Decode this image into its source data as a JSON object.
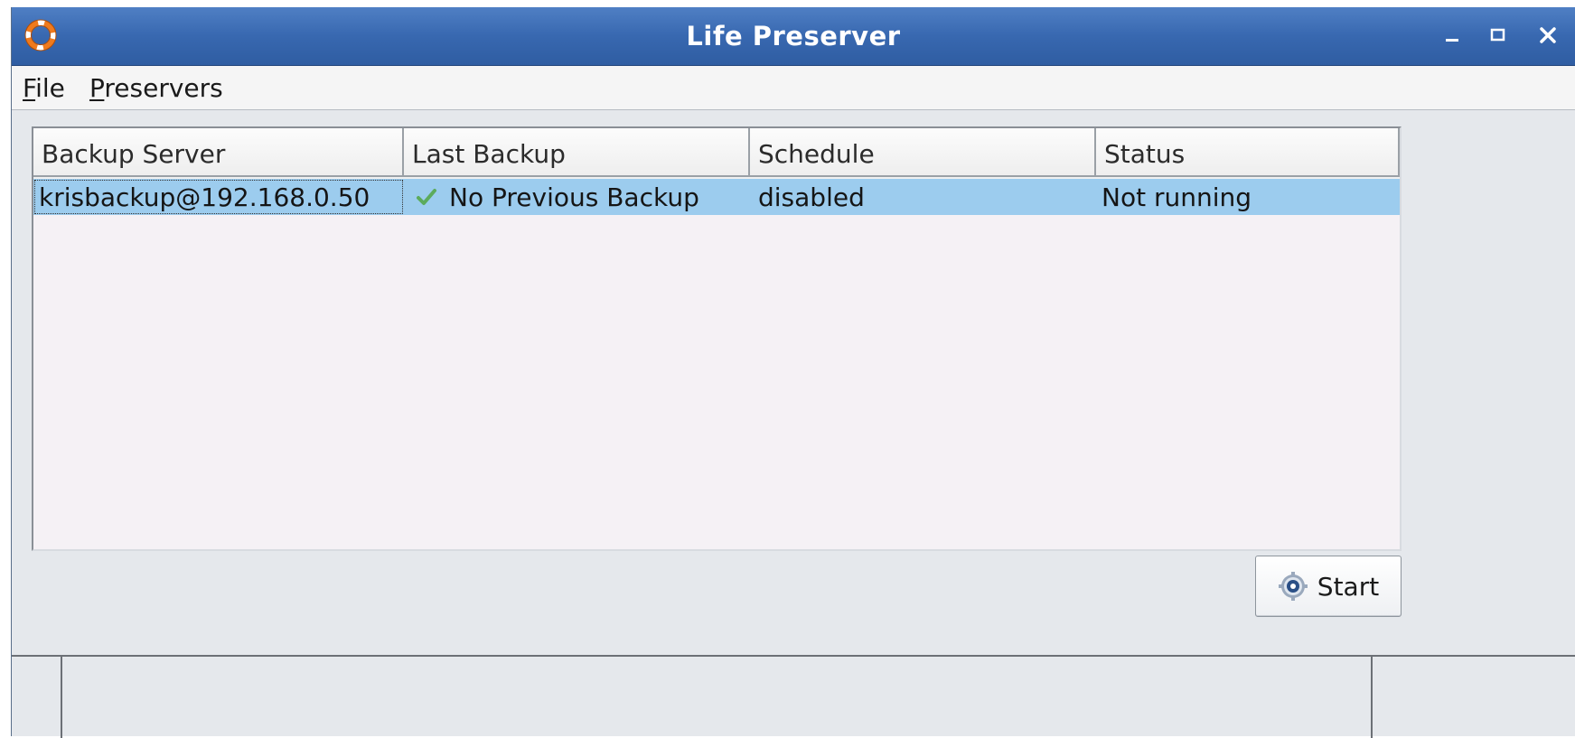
{
  "window": {
    "title": "Life Preserver",
    "controls": {
      "minimize": "_",
      "maximize": "□",
      "close": "✕"
    }
  },
  "menubar": {
    "file": {
      "mnemonic": "F",
      "rest": "ile"
    },
    "preservers": {
      "mnemonic": "P",
      "rest": "reservers"
    }
  },
  "table": {
    "columns": [
      "Backup Server",
      "Last Backup",
      "Schedule",
      "Status"
    ],
    "rows": [
      {
        "backup_server": "krisbackup@192.168.0.50",
        "last_backup": "No Previous Backup",
        "last_backup_icon": "check-icon",
        "schedule": "disabled",
        "status": "Not running"
      }
    ]
  },
  "actions": {
    "start_label": "Start",
    "start_icon": "gear-icon"
  },
  "colors": {
    "titlebar": "#3868b0",
    "selected_row": "#9cccee",
    "table_background": "#f5f1f5",
    "window_background": "#e5e8ec"
  }
}
